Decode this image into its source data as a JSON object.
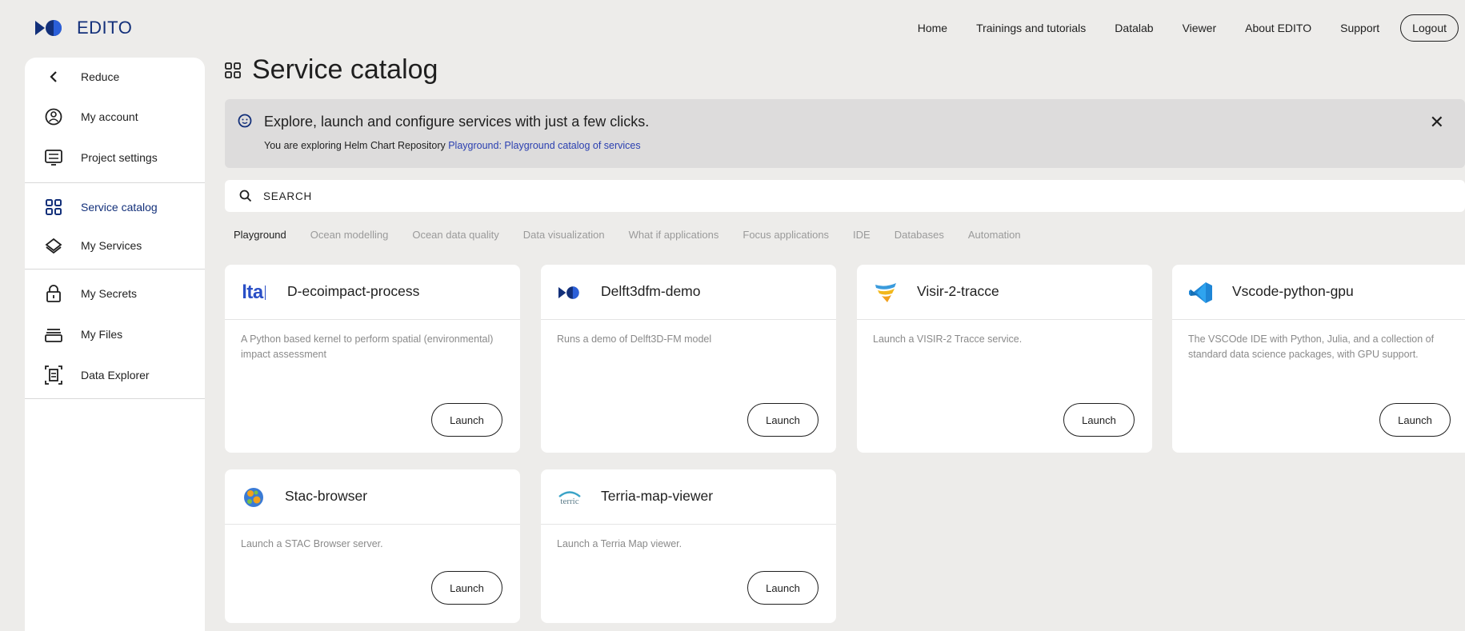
{
  "app": {
    "name": "EDITO"
  },
  "topnav": {
    "items": [
      "Home",
      "Trainings and tutorials",
      "Datalab",
      "Viewer",
      "About EDITO",
      "Support"
    ],
    "logout": "Logout"
  },
  "sidebar": {
    "items": [
      {
        "label": "Reduce",
        "icon": "chevron-left-icon"
      },
      {
        "label": "My account",
        "icon": "account-icon"
      },
      {
        "label": "Project settings",
        "icon": "settings-icon"
      },
      {
        "label": "Service catalog",
        "icon": "grid-icon",
        "active": true
      },
      {
        "label": "My Services",
        "icon": "layers-icon"
      },
      {
        "label": "My Secrets",
        "icon": "lock-icon"
      },
      {
        "label": "My Files",
        "icon": "folder-icon"
      },
      {
        "label": "Data Explorer",
        "icon": "data-explorer-icon"
      }
    ]
  },
  "main": {
    "title": "Service catalog",
    "banner": {
      "main": "Explore, launch and configure services with just a few clicks.",
      "sub_prefix": "You are exploring Helm Chart Repository ",
      "sub_link": "Playground: Playground catalog of services"
    },
    "search": {
      "placeholder": "SEARCH"
    },
    "tabs": [
      "Playground",
      "Ocean modelling",
      "Ocean data quality",
      "Data visualization",
      "What if applications",
      "Focus applications",
      "IDE",
      "Databases",
      "Automation"
    ],
    "active_tab": "Playground",
    "cards": [
      {
        "title": "D-ecoimpact-process",
        "desc": "A Python based kernel to perform spatial (environmental) impact assessment",
        "logo": "lta-logo",
        "launch": "Launch"
      },
      {
        "title": "Delft3dfm-demo",
        "desc": "Runs a demo of Delft3D-FM model",
        "logo": "deltares-logo",
        "launch": "Launch"
      },
      {
        "title": "Visir-2-tracce",
        "desc": "Launch a VISIR-2 Tracce service.",
        "logo": "visir-logo",
        "launch": "Launch"
      },
      {
        "title": "Vscode-python-gpu",
        "desc": "The VSCOde IDE with Python, Julia, and a collection of standard data science packages, with GPU support.",
        "logo": "vscode-logo",
        "launch": "Launch"
      },
      {
        "title": "Stac-browser",
        "desc": "Launch a STAC Browser server.",
        "logo": "stac-logo",
        "launch": "Launch"
      },
      {
        "title": "Terria-map-viewer",
        "desc": "Launch a Terria Map viewer.",
        "logo": "terria-logo",
        "logo_text": "terric",
        "launch": "Launch"
      }
    ]
  },
  "colors": {
    "brand": "#13307a",
    "link": "#2a3fb0",
    "background": "#edecea",
    "banner": "#dddcdc"
  }
}
